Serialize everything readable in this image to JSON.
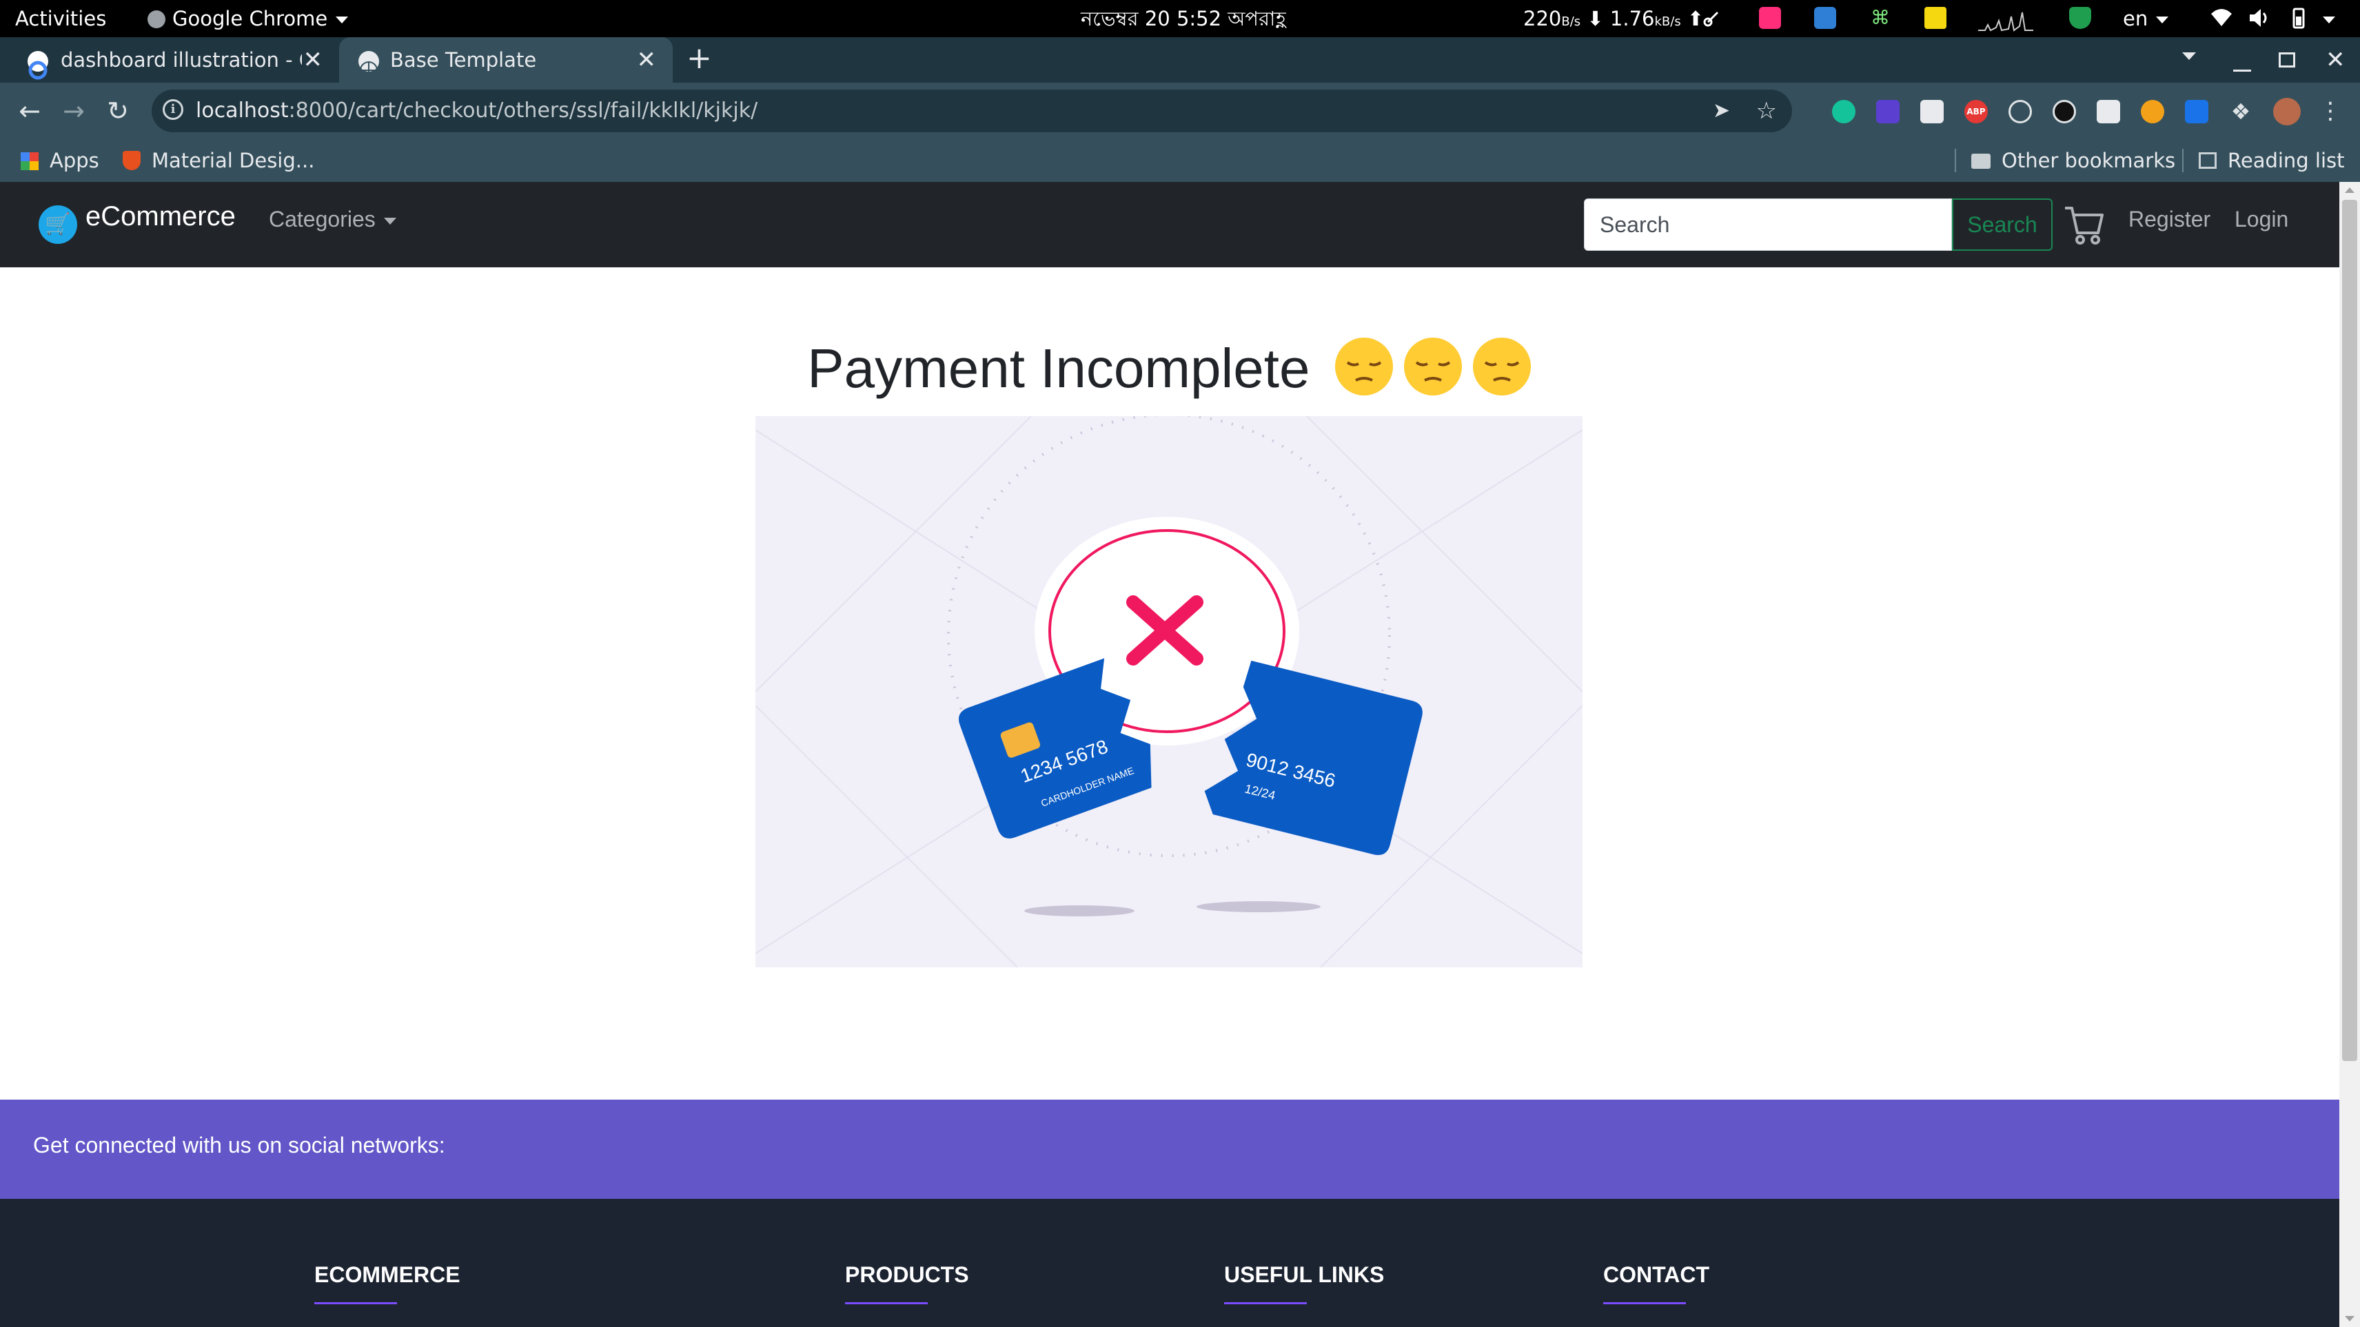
{
  "os_bar": {
    "activities": "Activities",
    "app_menu": "Google Chrome",
    "datetime": "নভেম্বর 20   5:52 অপরাহ্ণ",
    "net_down": "220",
    "net_down_unit": "B/s",
    "net_up": "1.76",
    "net_up_unit": "kB/s",
    "language": "en"
  },
  "browser": {
    "tabs": [
      {
        "title": "dashboard illustration - Go",
        "active": false
      },
      {
        "title": "Base Template",
        "active": true
      }
    ],
    "new_tab": "+",
    "url_host": "localhost",
    "url_path": ":8000/cart/checkout/others/ssl/fail/kklkl/kjkjk/",
    "bookmarks": {
      "apps": "Apps",
      "material": "Material Desig...",
      "other": "Other bookmarks",
      "reading": "Reading list"
    }
  },
  "navbar": {
    "brand": "eCommerce",
    "categories": "Categories",
    "search_placeholder": "Search",
    "search_button": "Search",
    "register": "Register",
    "login": "Login"
  },
  "main": {
    "heading": "Payment Incomplete",
    "card_left_number": "1234 5678",
    "card_left_holder": "CARDHOLDER NAME",
    "card_right_number": "9012 3456",
    "card_right_expiry": "12/24"
  },
  "footer": {
    "social_text": "Get connected with us on social networks:",
    "columns": [
      "ECOMMERCE",
      "PRODUCTS",
      "USEFUL LINKS",
      "CONTACT"
    ]
  },
  "colors": {
    "navbar_bg": "#212529",
    "social_band": "#6256c8",
    "footer_bg": "#1c2331",
    "success": "#198754",
    "error_x": "#f0185f",
    "card_blue": "#0a5bc4"
  }
}
